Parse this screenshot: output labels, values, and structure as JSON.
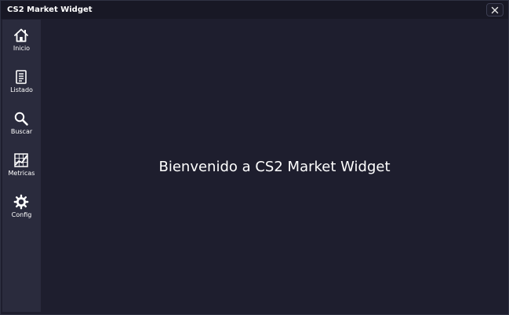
{
  "window": {
    "title": "CS2 Market Widget",
    "close_symbol": "✕"
  },
  "sidebar": {
    "items": [
      {
        "label": "Inicio",
        "icon": "home-icon"
      },
      {
        "label": "Listado",
        "icon": "list-icon"
      },
      {
        "label": "Buscar",
        "icon": "search-icon"
      },
      {
        "label": "Metricas",
        "icon": "chart-icon"
      },
      {
        "label": "Config",
        "icon": "gear-icon"
      }
    ]
  },
  "main": {
    "welcome_text": "Bienvenido a CS2 Market Widget"
  },
  "colors": {
    "titlebar_bg": "#181825",
    "sidebar_bg": "#2a2b3d",
    "content_bg": "#1e1e2e",
    "text": "#ffffff"
  }
}
